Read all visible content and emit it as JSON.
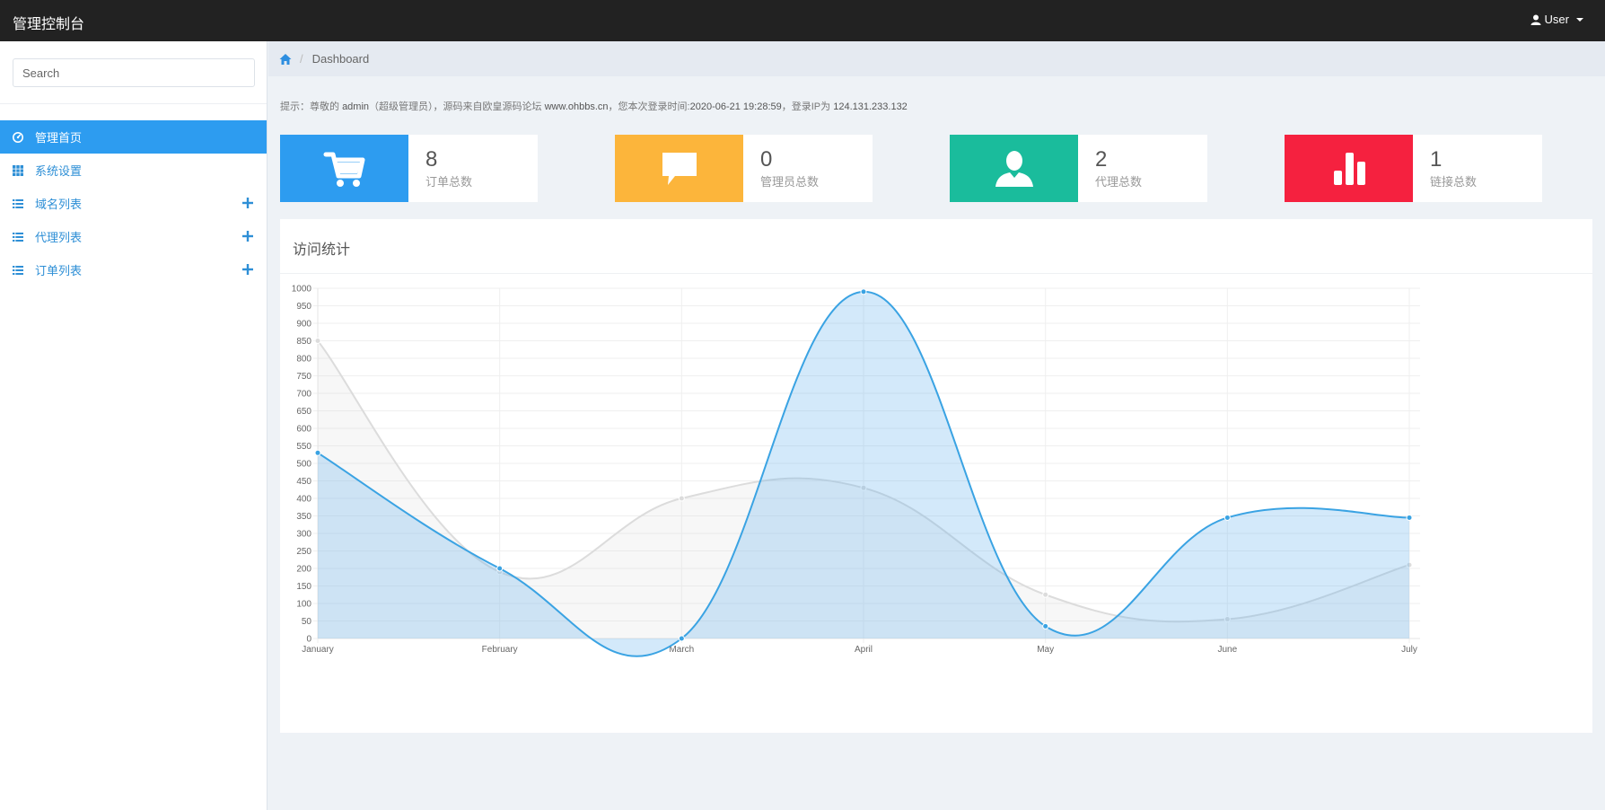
{
  "topbar": {
    "brand": "管理控制台",
    "user_label": "User"
  },
  "sidebar": {
    "search_placeholder": "Search",
    "items": [
      {
        "label": "管理首页",
        "icon": "dashboard-icon",
        "active": true,
        "expandable": false
      },
      {
        "label": "系统设置",
        "icon": "grid-icon",
        "active": false,
        "expandable": false
      },
      {
        "label": "域名列表",
        "icon": "list-icon",
        "active": false,
        "expandable": true
      },
      {
        "label": "代理列表",
        "icon": "list-icon",
        "active": false,
        "expandable": true
      },
      {
        "label": "订单列表",
        "icon": "list-icon",
        "active": false,
        "expandable": true
      }
    ]
  },
  "breadcrumb": {
    "current": "Dashboard"
  },
  "notice": {
    "prefix": "提示：尊敬的",
    "username": "admin",
    "role": "（超级管理员）",
    "source_text": "，源码来自欧皇源码论坛",
    "site": "www.ohbbs.cn",
    "login_time_label": "，您本次登录时间:",
    "login_time": "2020-06-21 19:28:59",
    "ip_label": "，登录IP为",
    "ip": "124.131.233.132"
  },
  "stats": [
    {
      "value": "8",
      "label": "订单总数",
      "color": "#2d9cf0",
      "icon": "cart-icon"
    },
    {
      "value": "0",
      "label": "管理员总数",
      "color": "#fcb53b",
      "icon": "comment-icon"
    },
    {
      "value": "2",
      "label": "代理总数",
      "color": "#1abc9c",
      "icon": "user-icon"
    },
    {
      "value": "1",
      "label": "链接总数",
      "color": "#f5213f",
      "icon": "bar-chart-icon"
    }
  ],
  "panel": {
    "title": "访问统计"
  },
  "chart_data": {
    "type": "area",
    "categories": [
      "January",
      "February",
      "March",
      "April",
      "May",
      "June",
      "July"
    ],
    "series": [
      {
        "values": [
          850,
          190,
          400,
          430,
          125,
          55,
          210
        ],
        "color": "#dcdcdc"
      },
      {
        "values": [
          530,
          200,
          0,
          990,
          35,
          345,
          345
        ],
        "color": "#3aa3e3"
      }
    ],
    "ylim": [
      0,
      1000
    ],
    "yticks": [
      0,
      50,
      100,
      150,
      200,
      250,
      300,
      350,
      400,
      450,
      500,
      550,
      600,
      650,
      700,
      750,
      800,
      850,
      900,
      950,
      1000
    ],
    "grid": true,
    "legend": "none"
  }
}
